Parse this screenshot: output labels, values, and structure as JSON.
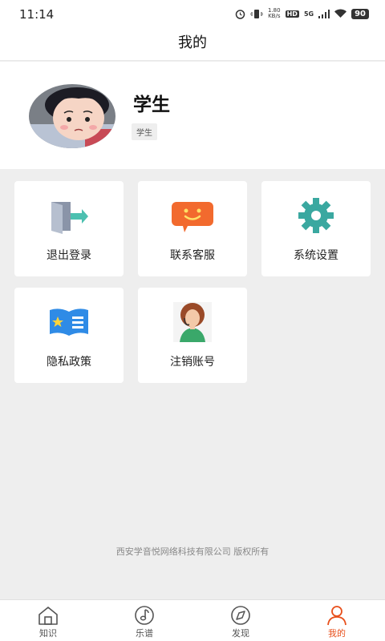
{
  "status_bar": {
    "time": "11:14",
    "net_speed_value": "1.80",
    "net_speed_unit": "KB/s",
    "hd": "HD",
    "network": "5G",
    "battery": "90"
  },
  "header": {
    "title": "我的"
  },
  "profile": {
    "name": "学生",
    "role_badge": "学生"
  },
  "menu": [
    {
      "label": "退出登录",
      "icon": "logout-door-icon"
    },
    {
      "label": "联系客服",
      "icon": "customer-service-chat-icon"
    },
    {
      "label": "系统设置",
      "icon": "settings-gear-icon"
    },
    {
      "label": "隐私政策",
      "icon": "privacy-book-icon"
    },
    {
      "label": "注销账号",
      "icon": "cancel-account-person-icon"
    }
  ],
  "footer": {
    "copyright": "西安学音悦网络科技有限公司 版权所有"
  },
  "tabbar": {
    "active": "我的",
    "active_color": "#e8501c",
    "tabs": [
      {
        "label": "知识",
        "icon": "home-icon"
      },
      {
        "label": "乐谱",
        "icon": "music-note-icon"
      },
      {
        "label": "发现",
        "icon": "compass-icon"
      },
      {
        "label": "我的",
        "icon": "person-icon"
      }
    ]
  }
}
